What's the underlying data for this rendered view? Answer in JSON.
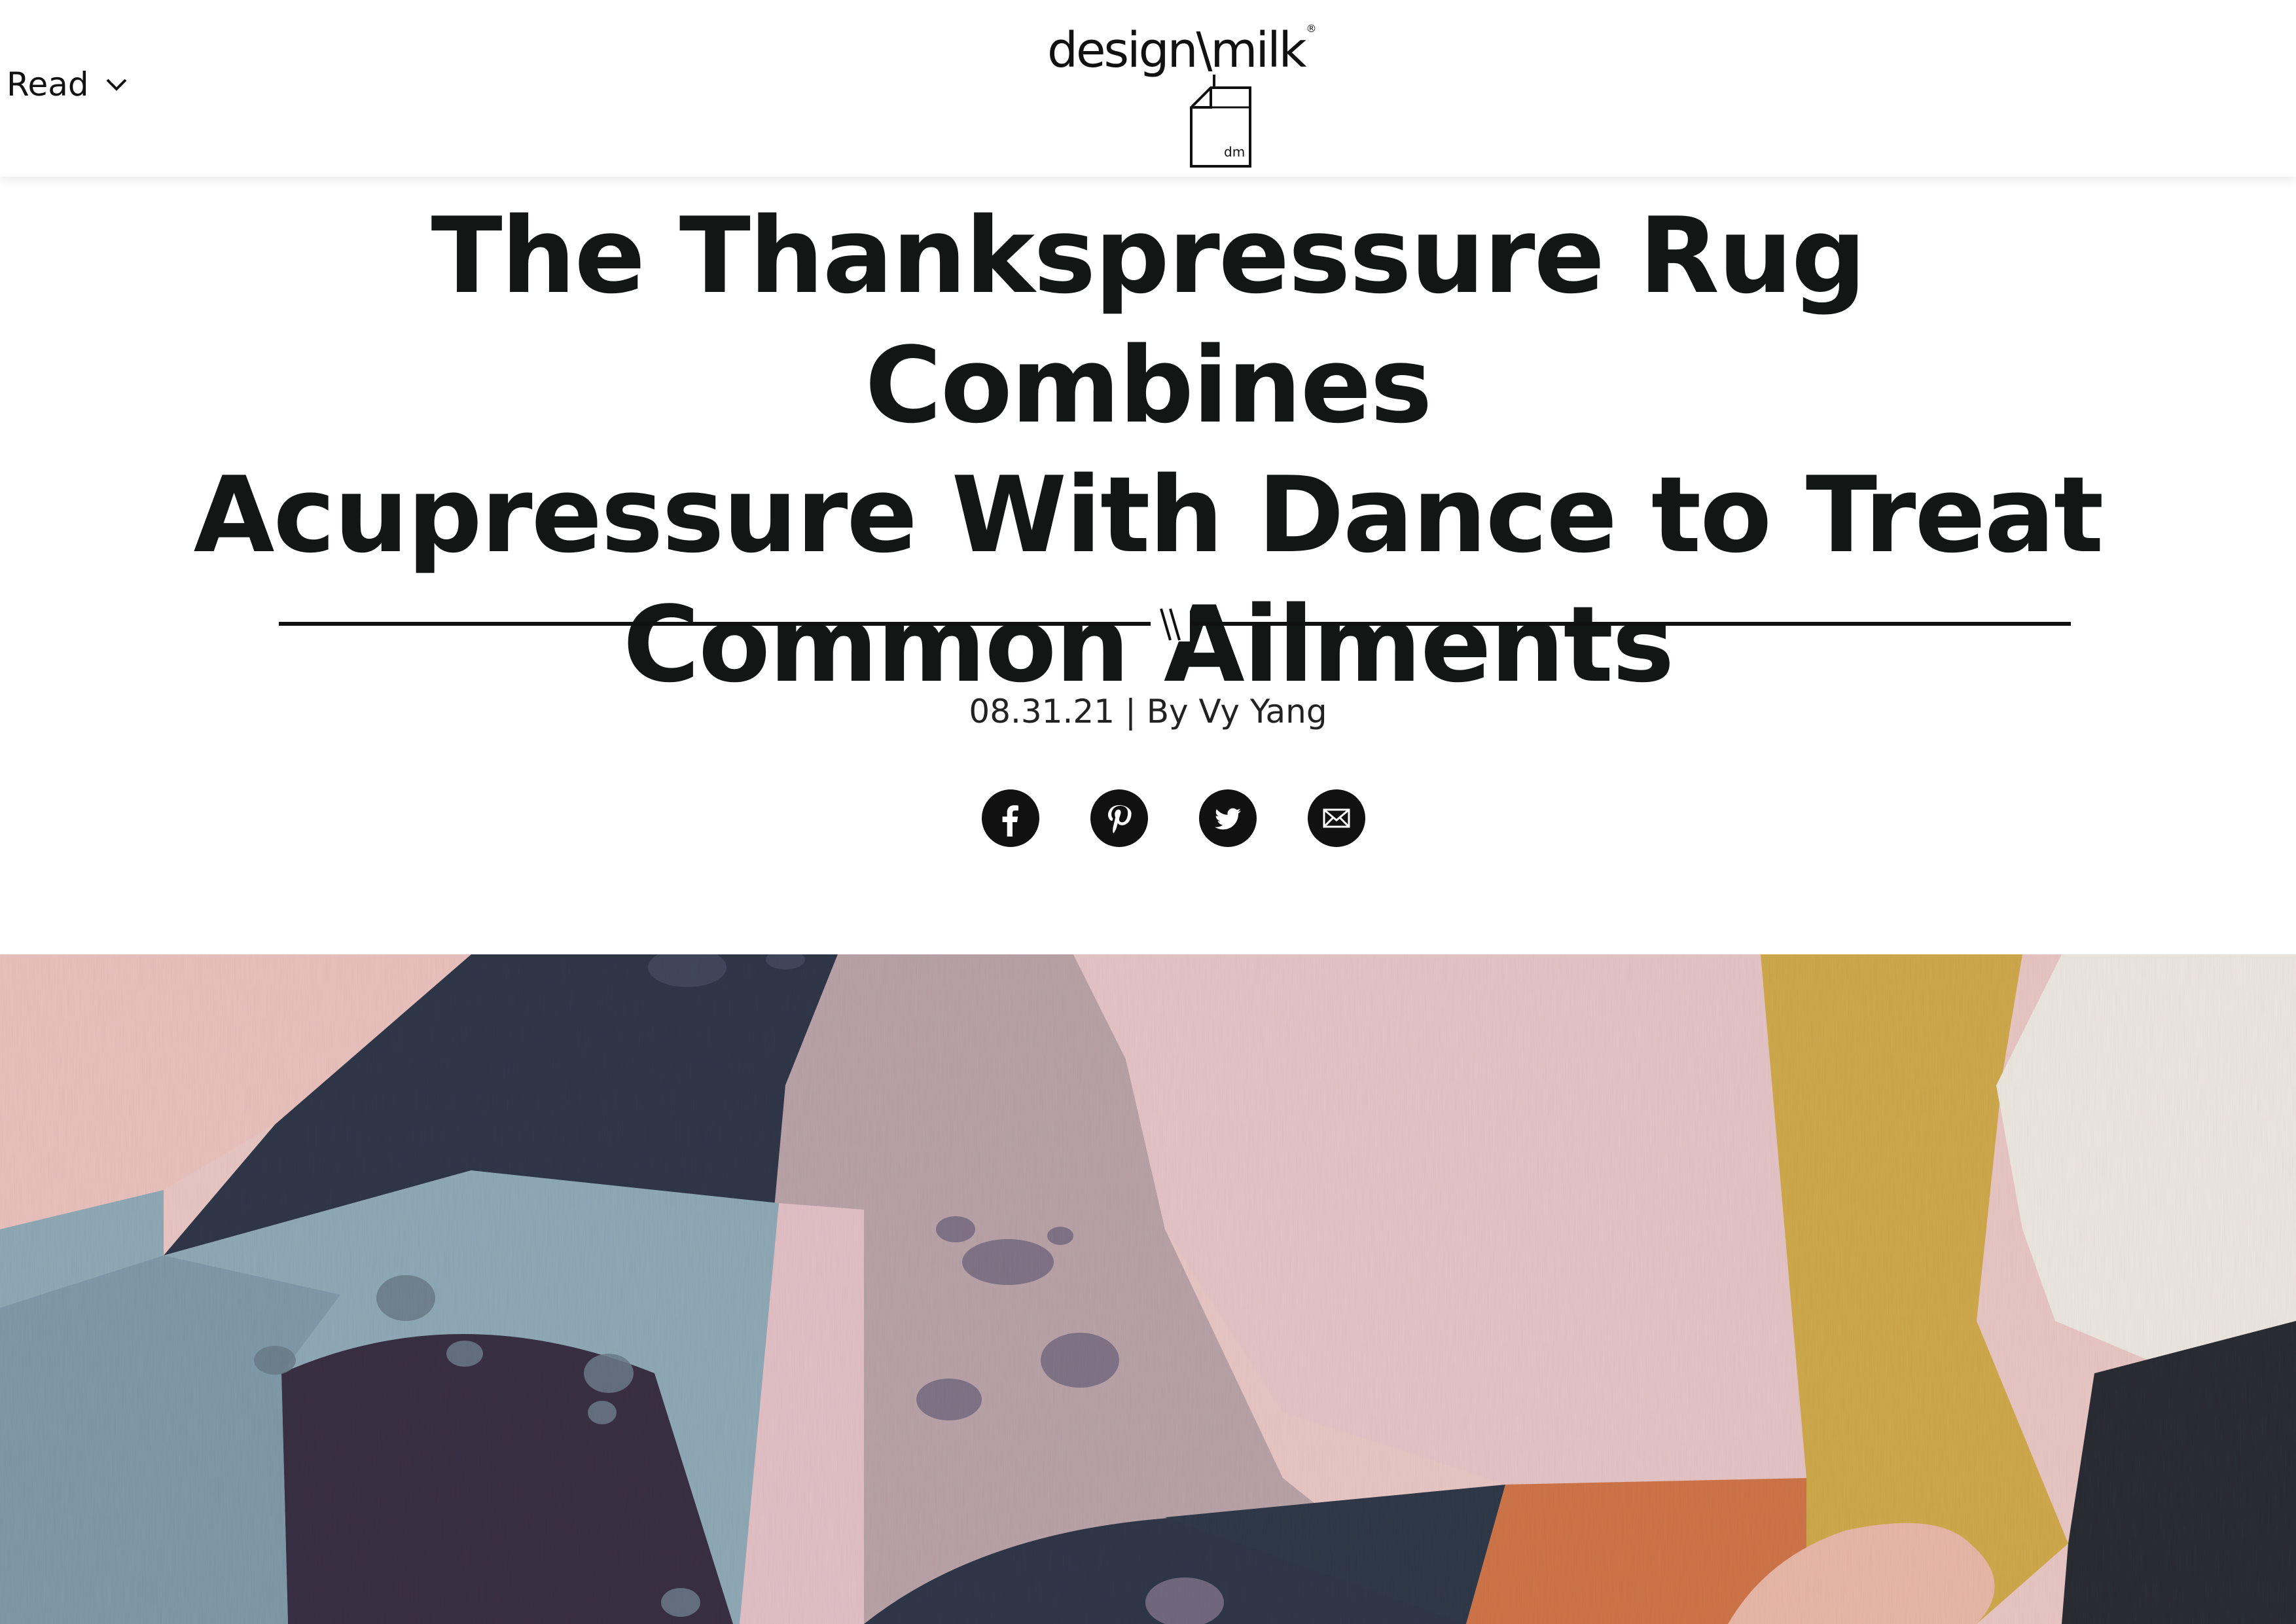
{
  "header": {
    "read_label": "Read",
    "logo_text": "design\\milk",
    "logo_reg": "®",
    "logo_carton_text": "dm"
  },
  "article": {
    "title_line1": "The Thankspressure Rug Combines",
    "title_line2": "Acupressure With Dance to Treat",
    "title_line3": "Common Ailments",
    "date": "08.31.21",
    "byline_separator": "|",
    "author_prefix": "By",
    "author": "Vy Yang"
  },
  "share": {
    "icons": [
      "facebook-icon",
      "pinterest-icon",
      "twitter-icon",
      "email-icon"
    ]
  },
  "colors": {
    "text": "#141616",
    "accent": "#111111",
    "rug_pink": "#e6c3c2",
    "rug_navy": "#2e3648",
    "rug_blue": "#8aa6b4",
    "rug_mauve": "#b9a2a6",
    "rug_mustard": "#cda84a",
    "rug_orange": "#d0764a"
  }
}
